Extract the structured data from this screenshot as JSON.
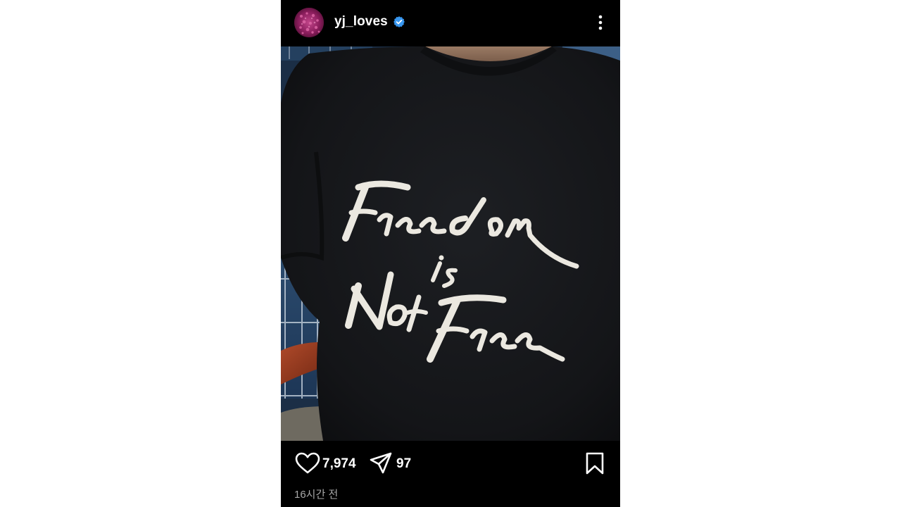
{
  "post": {
    "username": "yj_loves",
    "verified": true,
    "timestamp": "16시간 전",
    "shirt_text": [
      "Freedom",
      "is",
      "Not",
      "Free"
    ]
  },
  "actions": {
    "like_count": "7,974",
    "share_count": "97"
  },
  "icons": {
    "more": "more-vertical-icon",
    "like": "heart-icon",
    "share": "paper-plane-icon",
    "bookmark": "bookmark-icon",
    "verified": "verified-badge-icon"
  },
  "colors": {
    "background": "#000000",
    "verified": "#3897f0",
    "timestamp": "#a8a8a8"
  }
}
